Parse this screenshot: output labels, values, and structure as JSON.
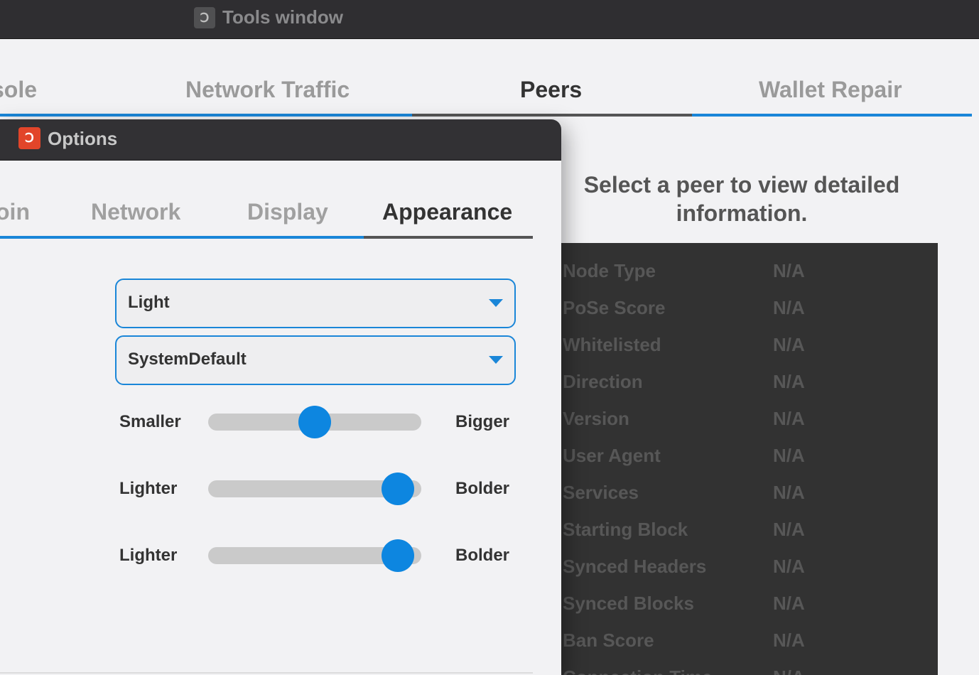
{
  "tools_window": {
    "title": "Tools window",
    "app_icon": "dash-logo-icon",
    "tabs": [
      {
        "label": "sole",
        "active": false
      },
      {
        "label": "Network Traffic",
        "active": false
      },
      {
        "label": "Peers",
        "active": true
      },
      {
        "label": "Wallet Repair",
        "active": false
      }
    ],
    "peer_message": "Select a peer to view detailed information.",
    "peer_details": [
      {
        "label": "Node Type",
        "value": "N/A"
      },
      {
        "label": "PoSe Score",
        "value": "N/A"
      },
      {
        "label": "Whitelisted",
        "value": "N/A"
      },
      {
        "label": "Direction",
        "value": "N/A"
      },
      {
        "label": "Version",
        "value": "N/A"
      },
      {
        "label": "User Agent",
        "value": "N/A"
      },
      {
        "label": "Services",
        "value": "N/A"
      },
      {
        "label": "Starting Block",
        "value": "N/A"
      },
      {
        "label": "Synced Headers",
        "value": "N/A"
      },
      {
        "label": "Synced Blocks",
        "value": "N/A"
      },
      {
        "label": "Ban Score",
        "value": "N/A"
      },
      {
        "label": "Connection Time",
        "value": "N/A"
      }
    ]
  },
  "options_window": {
    "title": "Options",
    "app_icon": "dash-logo-icon",
    "tabs": [
      {
        "label": "oin",
        "active": false
      },
      {
        "label": "Network",
        "active": false
      },
      {
        "label": "Display",
        "active": false
      },
      {
        "label": "Appearance",
        "active": true
      }
    ],
    "theme_select": {
      "value": "Light"
    },
    "font_family_select": {
      "value": "SystemDefault"
    },
    "sliders": [
      {
        "min_label": "Smaller",
        "max_label": "Bigger",
        "value": 0.5
      },
      {
        "min_label": "Lighter",
        "max_label": "Bolder",
        "value": 0.89
      },
      {
        "min_label": "Lighter",
        "max_label": "Bolder",
        "value": 0.89
      }
    ]
  },
  "colors": {
    "accent": "#0d86e0",
    "active_tab_underline": "#555555",
    "dark_titlebar": "#2f2e31",
    "peer_table_bg": "#323232"
  }
}
